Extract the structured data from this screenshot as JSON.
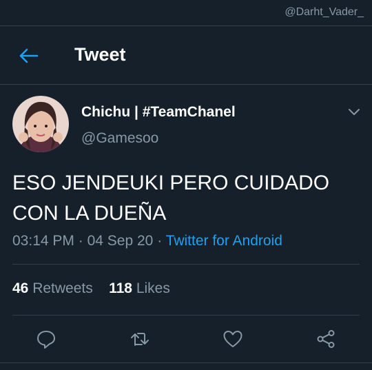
{
  "watermark": "@Darht_Vader_",
  "header": {
    "title": "Tweet"
  },
  "tweet": {
    "author_name": "Chichu | #TeamChanel",
    "author_handle": "@Gamesoo",
    "text_line1": "ESO JENDEUKI PERO CUIDADO",
    "text_line2": "CON LA DUEÑA",
    "time": "03:14 PM",
    "date": "04 Sep 20",
    "separator": "·",
    "source": "Twitter for Android",
    "retweets_count": "46",
    "retweets_label": "Retweets",
    "likes_count": "118",
    "likes_label": "Likes"
  },
  "colors": {
    "background": "#15202b",
    "accent": "#1da1f2",
    "secondary_text": "#8899a6",
    "divider": "#2f3e4c"
  },
  "icons": [
    "back-arrow-icon",
    "chevron-down-icon",
    "reply-icon",
    "retweet-icon",
    "like-icon",
    "share-icon"
  ]
}
